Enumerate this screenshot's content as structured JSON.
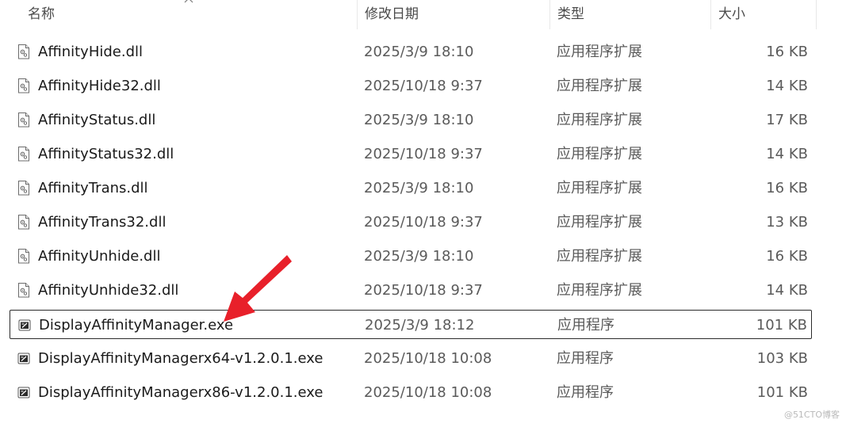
{
  "header": {
    "name": "名称",
    "date": "修改日期",
    "type": "类型",
    "size": "大小"
  },
  "files": [
    {
      "name": "AffinityHide.dll",
      "date": "2025/3/9 18:10",
      "type": "应用程序扩展",
      "size": "16 KB",
      "icon": "dll-file-icon"
    },
    {
      "name": "AffinityHide32.dll",
      "date": "2025/10/18 9:37",
      "type": "应用程序扩展",
      "size": "14 KB",
      "icon": "dll-file-icon"
    },
    {
      "name": "AffinityStatus.dll",
      "date": "2025/3/9 18:10",
      "type": "应用程序扩展",
      "size": "17 KB",
      "icon": "dll-file-icon"
    },
    {
      "name": "AffinityStatus32.dll",
      "date": "2025/10/18 9:37",
      "type": "应用程序扩展",
      "size": "14 KB",
      "icon": "dll-file-icon"
    },
    {
      "name": "AffinityTrans.dll",
      "date": "2025/3/9 18:10",
      "type": "应用程序扩展",
      "size": "16 KB",
      "icon": "dll-file-icon"
    },
    {
      "name": "AffinityTrans32.dll",
      "date": "2025/10/18 9:37",
      "type": "应用程序扩展",
      "size": "13 KB",
      "icon": "dll-file-icon"
    },
    {
      "name": "AffinityUnhide.dll",
      "date": "2025/3/9 18:10",
      "type": "应用程序扩展",
      "size": "16 KB",
      "icon": "dll-file-icon"
    },
    {
      "name": "AffinityUnhide32.dll",
      "date": "2025/10/18 9:37",
      "type": "应用程序扩展",
      "size": "14 KB",
      "icon": "dll-file-icon"
    },
    {
      "name": "DisplayAffinityManager.exe",
      "date": "2025/3/9 18:12",
      "type": "应用程序",
      "size": "101 KB",
      "icon": "exe-file-icon",
      "selected": true
    },
    {
      "name": "DisplayAffinityManagerx64-v1.2.0.1.exe",
      "date": "2025/10/18 10:08",
      "type": "应用程序",
      "size": "103 KB",
      "icon": "exe-file-icon"
    },
    {
      "name": "DisplayAffinityManagerx86-v1.2.0.1.exe",
      "date": "2025/10/18 10:08",
      "type": "应用程序",
      "size": "101 KB",
      "icon": "exe-file-icon"
    }
  ],
  "annotation": {
    "arrow_color": "#e8202a"
  },
  "watermark": "@51CTO博客"
}
